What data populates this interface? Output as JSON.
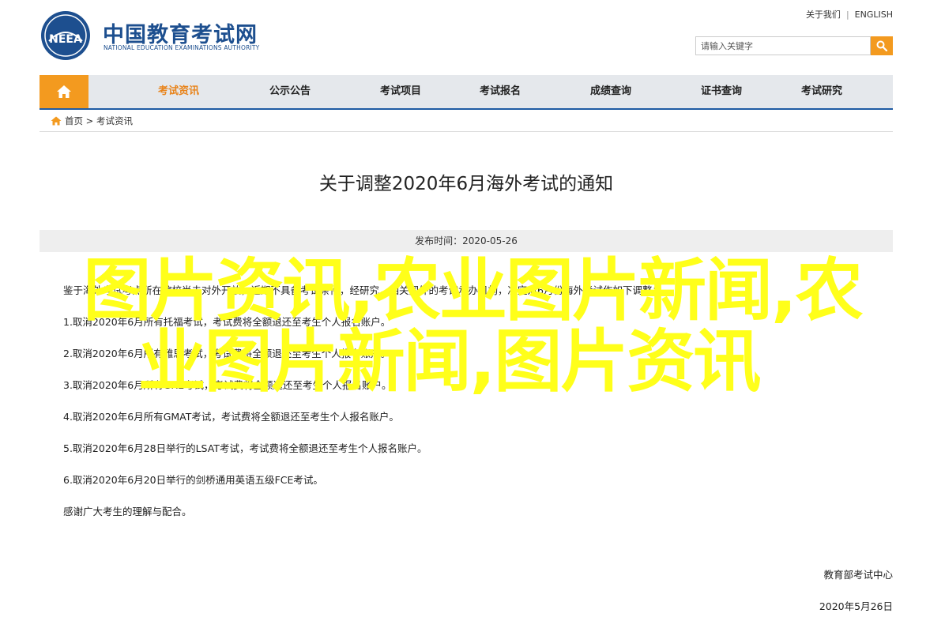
{
  "header": {
    "logo_cn": "中国教育考试网",
    "logo_en": "NATIONAL EDUCATION EXAMINATIONS AUTHORITY",
    "logo_badge": "NEEA",
    "links": [
      "关于我们",
      "ENGLISH"
    ],
    "search_placeholder": "请输入关键字"
  },
  "nav": {
    "items": [
      "考试资讯",
      "公示公告",
      "考试项目",
      "考试报名",
      "成绩查询",
      "证书查询",
      "考试研究"
    ],
    "active": "考试资讯"
  },
  "breadcrumb": {
    "home": "首页",
    "separator": ">",
    "current": "考试资讯"
  },
  "article": {
    "title": "关于调整2020年6月海外考试的通知",
    "publish_label": "发布时间：2020-05-26",
    "paragraphs": [
      "鉴于海外考试考点所在院校尚未对外开放，近期不具备考试条件，经研究，相关国外的考试承办机构，决定对6月份海外考试作如下调整：",
      "1.取消2020年6月所有托福考试，考试费将全额退还至考生个人报名账户。",
      "2.取消2020年6月所有雅思考试，考试费将全额退还至考生个人报名账户。",
      "3.取消2020年6月所有GRE考试，考试费将全额退还至考生个人报名账户。",
      "4.取消2020年6月所有GMAT考试，考试费将全额退还至考生个人报名账户。",
      "5.取消2020年6月28日举行的LSAT考试，考试费将全额退还至考生个人报名账户。",
      "6.取消2020年6月20日举行的剑桥通用英语五级FCE考试。",
      "感谢广大考生的理解与配合。"
    ],
    "signature": "教育部考试中心",
    "sign_date": "2020年5月26日"
  },
  "overlay": {
    "line1": "图片资讯,农业图片新闻,农",
    "line2": "业图片新闻,图片资讯"
  },
  "colors": {
    "accent": "#f39a1f",
    "brand": "#1d4f8f",
    "nav_border": "#1f5ba3",
    "overlay": "#ffff1a"
  }
}
